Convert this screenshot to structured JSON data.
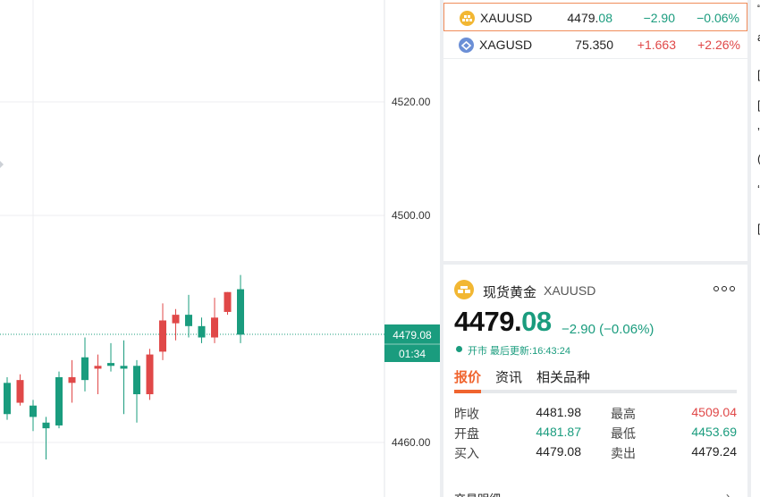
{
  "chart": {
    "price_axis": [
      "4520.00",
      "4500.00",
      "4460.00"
    ],
    "current_price": "4479.08",
    "countdown": "01:34",
    "colors": {
      "up": "#e04848",
      "down": "#1a9c7e",
      "grid": "#eceef1"
    },
    "candles": [
      {
        "o": 4470.5,
        "c": 4465.0,
        "h": 4471.5,
        "l": 4464.0
      },
      {
        "o": 4467.0,
        "c": 4471.0,
        "h": 4472.0,
        "l": 4466.5
      },
      {
        "o": 4466.5,
        "c": 4464.5,
        "h": 4467.5,
        "l": 4462.0
      },
      {
        "o": 4463.5,
        "c": 4462.5,
        "h": 4464.5,
        "l": 4457.0
      },
      {
        "o": 4471.5,
        "c": 4463.0,
        "h": 4472.5,
        "l": 4462.5
      },
      {
        "o": 4470.5,
        "c": 4471.5,
        "h": 4474.5,
        "l": 4467.0
      },
      {
        "o": 4475.0,
        "c": 4471.0,
        "h": 4478.5,
        "l": 4469.0
      },
      {
        "o": 4473.0,
        "c": 4473.5,
        "h": 4475.5,
        "l": 4468.5
      },
      {
        "o": 4474.0,
        "c": 4473.5,
        "h": 4477.5,
        "l": 4472.5
      },
      {
        "o": 4473.5,
        "c": 4473.0,
        "h": 4478.0,
        "l": 4465.0
      },
      {
        "o": 4473.5,
        "c": 4468.5,
        "h": 4474.5,
        "l": 4463.5
      },
      {
        "o": 4468.5,
        "c": 4475.5,
        "h": 4476.5,
        "l": 4467.5
      },
      {
        "o": 4476.0,
        "c": 4481.5,
        "h": 4484.5,
        "l": 4474.5
      },
      {
        "o": 4481.0,
        "c": 4482.5,
        "h": 4483.5,
        "l": 4478.0
      },
      {
        "o": 4482.5,
        "c": 4480.5,
        "h": 4486.0,
        "l": 4478.5
      },
      {
        "o": 4480.5,
        "c": 4478.5,
        "h": 4482.0,
        "l": 4477.5
      },
      {
        "o": 4478.5,
        "c": 4482.0,
        "h": 4485.5,
        "l": 4477.5
      },
      {
        "o": 4483.0,
        "c": 4486.5,
        "h": 4486.5,
        "l": 4482.5
      },
      {
        "o": 4487.0,
        "c": 4479.0,
        "h": 4489.5,
        "l": 4477.5
      }
    ]
  },
  "watchlist": [
    {
      "symbol": "XAUUSD",
      "price_main": "4479.",
      "price_tail": "08",
      "change": "−2.90",
      "pct": "−0.06%",
      "direction": "down",
      "icon": "gold-bars-icon",
      "icon_color": "#f2b733"
    },
    {
      "symbol": "XAGUSD",
      "price_main": "75.350",
      "price_tail": "",
      "change": "+1.663",
      "pct": "+2.26%",
      "direction": "up",
      "icon": "silver-icon",
      "icon_color": "#6b8fd6"
    }
  ],
  "detail": {
    "name": "现货黄金",
    "code": "XAUUSD",
    "price_main": "4479.",
    "price_tail": "08",
    "change": "−2.90 (−0.06%)",
    "status": "开市 最后更新:16:43:24",
    "tabs": [
      "报价",
      "资讯",
      "相关品种"
    ],
    "quotes": {
      "prev_close_label": "昨收",
      "prev_close": "4481.98",
      "open_label": "开盘",
      "open": "4481.87",
      "bid_label": "买入",
      "bid": "4479.08",
      "high_label": "最高",
      "high": "4509.04",
      "low_label": "最低",
      "low": "4453.69",
      "ask_label": "卖出",
      "ask": "4479.24"
    },
    "section_title": "交易明细"
  },
  "right_strip": [
    "“",
    "a",
    "[",
    "[",
    "’",
    "(",
    "‘",
    "["
  ]
}
